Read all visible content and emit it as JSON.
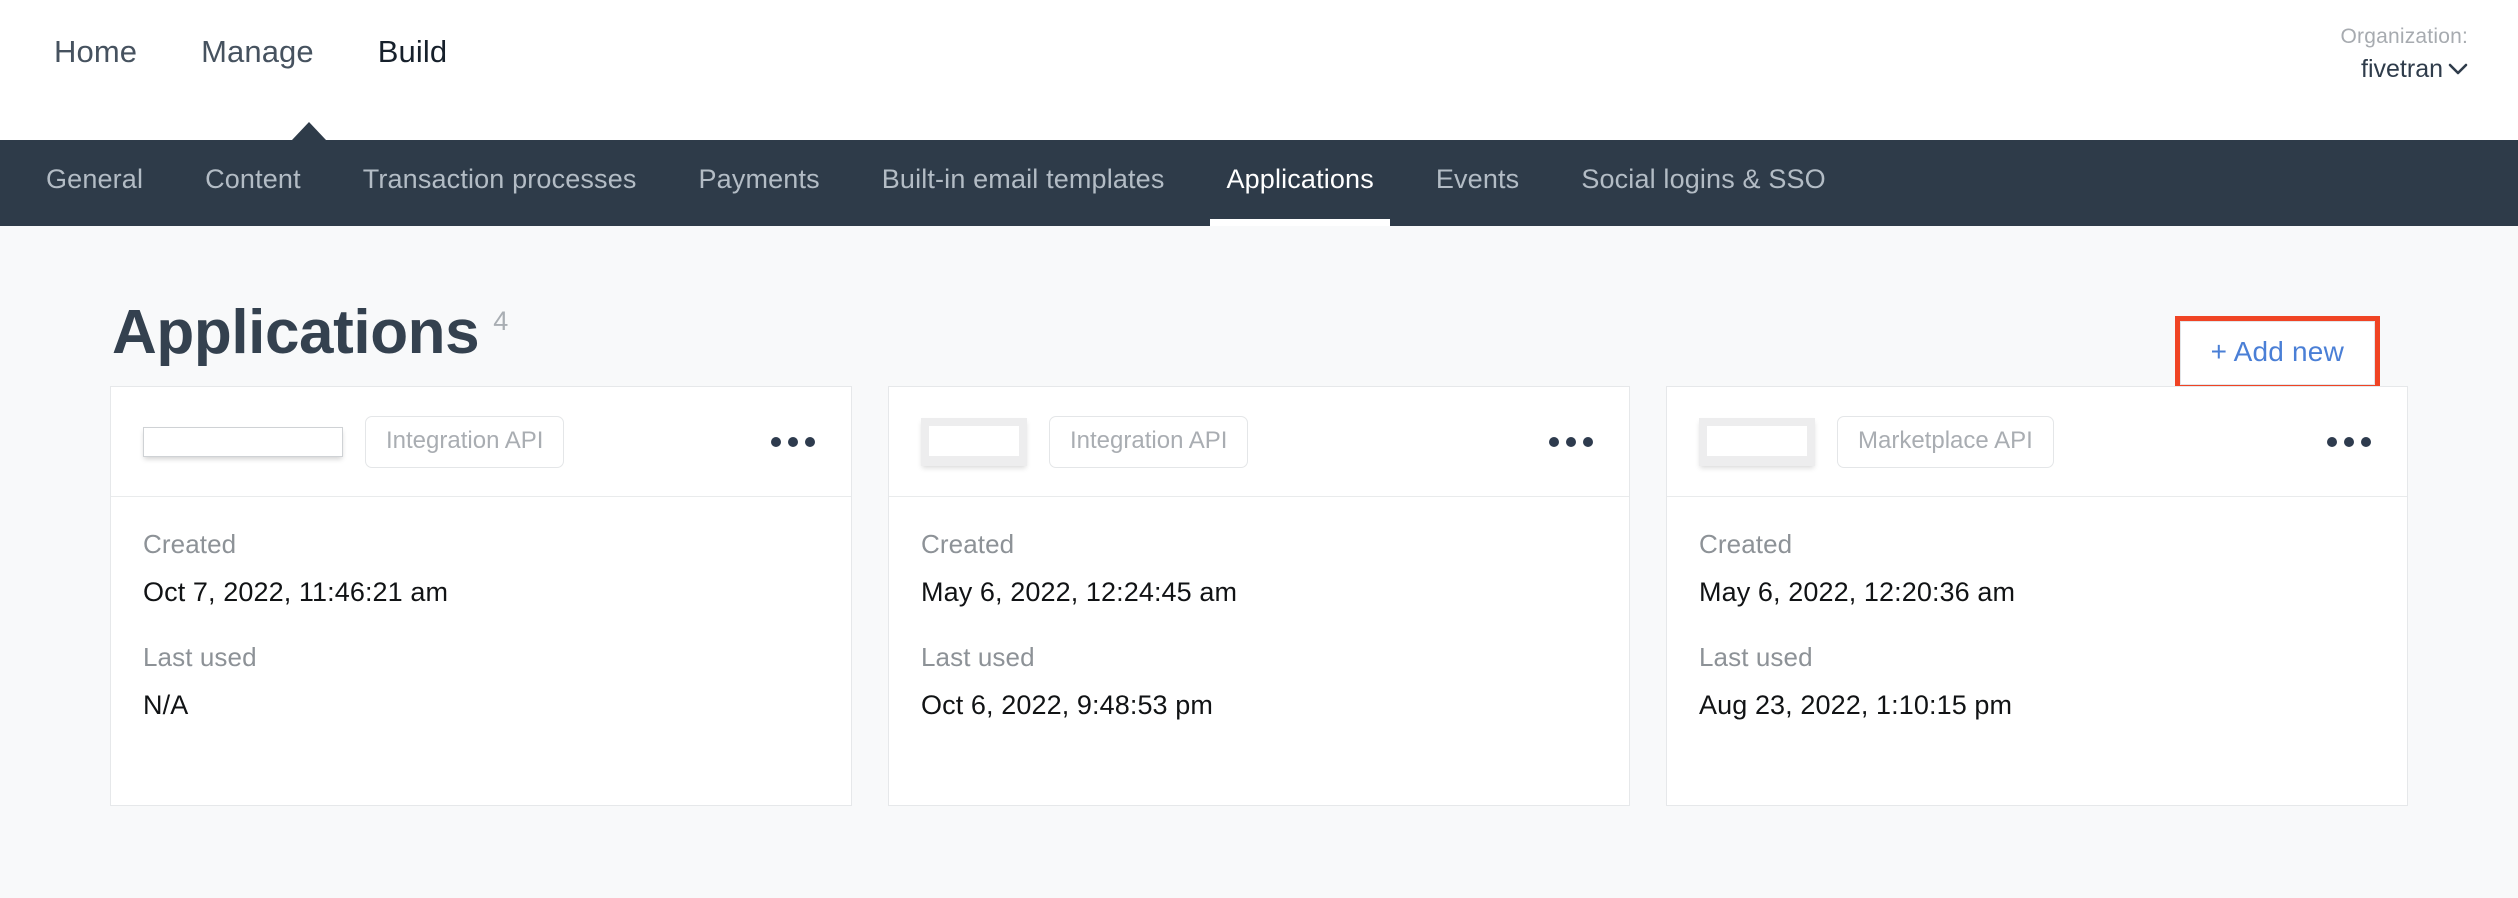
{
  "header": {
    "primary_nav": [
      {
        "label": "Home",
        "active": false
      },
      {
        "label": "Manage",
        "active": false
      },
      {
        "label": "Build",
        "active": true
      }
    ],
    "organization": {
      "label": "Organization:",
      "value": "fivetran",
      "caret": "chevron-down-icon",
      "caret_glyph": "⌄"
    }
  },
  "sub_nav": [
    {
      "label": "General",
      "active": false
    },
    {
      "label": "Content",
      "active": false
    },
    {
      "label": "Transaction processes",
      "active": false
    },
    {
      "label": "Payments",
      "active": false
    },
    {
      "label": "Built-in email templates",
      "active": false
    },
    {
      "label": "Applications",
      "active": true
    },
    {
      "label": "Events",
      "active": false
    },
    {
      "label": "Social logins & SSO",
      "active": false
    }
  ],
  "page": {
    "title": "Applications",
    "count": "4",
    "add_new_label": "+ Add new",
    "highlight_color": "#f04424",
    "link_color": "#4a7fd6",
    "nav_bar_color": "#2e3b49",
    "background_color": "#f8f9fa"
  },
  "cards": [
    {
      "name_redacted": true,
      "badge": "Integration API",
      "created_label": "Created",
      "created_value": "Oct 7, 2022, 11:46:21 am",
      "last_used_label": "Last used",
      "last_used_value": "N/A",
      "menu": "more-options-icon"
    },
    {
      "name_redacted": true,
      "badge": "Integration API",
      "created_label": "Created",
      "created_value": "May 6, 2022, 12:24:45 am",
      "last_used_label": "Last used",
      "last_used_value": "Oct 6, 2022, 9:48:53 pm",
      "menu": "more-options-icon"
    },
    {
      "name_redacted": true,
      "badge": "Marketplace API",
      "created_label": "Created",
      "created_value": "May 6, 2022, 12:20:36 am",
      "last_used_label": "Last used",
      "last_used_value": "Aug 23, 2022, 1:10:15 pm",
      "menu": "more-options-icon"
    }
  ]
}
